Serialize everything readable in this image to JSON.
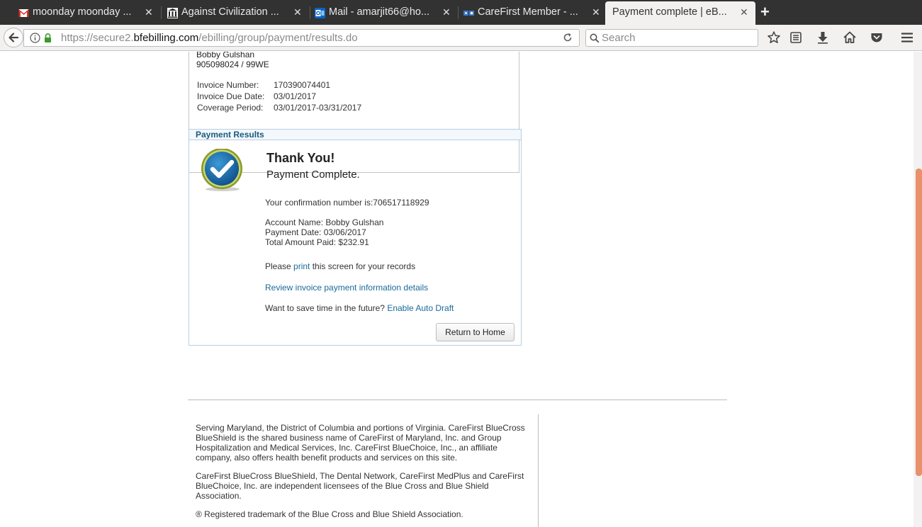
{
  "browser": {
    "tabs": [
      {
        "title": "moonday moonday ...",
        "icon": "gmail-icon"
      },
      {
        "title": "Against Civilization ...",
        "icon": "museum-icon"
      },
      {
        "title": "Mail - amarjit66@ho...",
        "icon": "outlook-icon"
      },
      {
        "title": "CareFirst Member - ...",
        "icon": "carefirst-icon"
      },
      {
        "title": "Payment complete | eB...",
        "icon": "none",
        "active": true
      }
    ],
    "url_prefix": "https://secure2.",
    "url_host": "bfebilling.com",
    "url_path": "/ebilling/group/payment/results.do",
    "search_placeholder": "Search"
  },
  "account": {
    "name": "Bobby Gulshan",
    "id": "905098024 / 99WE",
    "invoice_number_label": "Invoice Number:",
    "invoice_number": "170390074401",
    "due_date_label": "Invoice Due Date:",
    "due_date": "03/01/2017",
    "coverage_label": "Coverage Period:",
    "coverage": "03/01/2017-03/31/2017"
  },
  "results": {
    "header": "Payment Results",
    "thank_you": "Thank You!",
    "complete": "Payment Complete.",
    "confirmation": "Your confirmation number is:706517118929",
    "account_name": "Account Name: Bobby Gulshan",
    "payment_date": "Payment Date: 03/06/2017",
    "total_paid": "Total Amount Paid: $232.91",
    "print_prefix": "Please ",
    "print_link": "print",
    "print_suffix": " this screen for your records",
    "review_link": "Review invoice payment information details",
    "auto_draft_prefix": "Want to save time in the future? ",
    "auto_draft_link": "Enable Auto Draft",
    "home_button": "Return to Home"
  },
  "footer": {
    "p1": "Serving Maryland, the District of Columbia and portions of Virginia. CareFirst BlueCross BlueShield is the shared business name of CareFirst of Maryland, Inc. and Group Hospitalization and Medical Services, Inc. CareFirst BlueChoice, Inc., an affiliate company, also offers health benefit products and services on this site.",
    "p2": "CareFirst BlueCross BlueShield, The Dental Network, CareFirst MedPlus and CareFirst BlueChoice, Inc. are independent licensees of the Blue Cross and Blue Shield Association.",
    "p3": "® Registered trademark of the Blue Cross and Blue Shield Association."
  },
  "colors": {
    "tabstrip": "#323232",
    "link": "#1a6a9a",
    "results_border": "#b8cfe0",
    "scrollbar_thumb": "#e8916a"
  }
}
